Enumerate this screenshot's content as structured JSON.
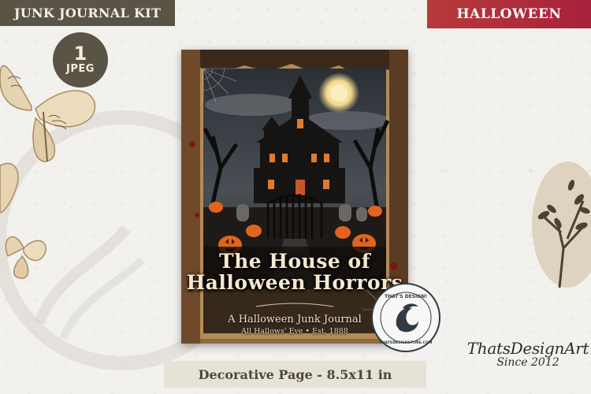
{
  "tags": {
    "left": "JUNK JOURNAL KIT",
    "right": "HALLOWEEN"
  },
  "badge": {
    "count": "1",
    "format": "JPEG"
  },
  "cover": {
    "title_line1": "The House of",
    "title_line2": "Halloween Horrors",
    "subtitle": "A Halloween Junk Journal",
    "subtitle2": "All Hallows' Eve • Est. 1888"
  },
  "stamp": {
    "ring_text": "THAT'S DESIGN! · THATSDESIGNSTORE.COM ·"
  },
  "banner": {
    "text": "Decorative Page - 8.5x11 in"
  },
  "brand": {
    "name": "ThatsDesignArt",
    "since": "Since 2012"
  },
  "colors": {
    "tag_left_bg": "#5a5446",
    "tag_right_bg": "#b73a3a",
    "banner_bg": "#e7e2d6"
  }
}
